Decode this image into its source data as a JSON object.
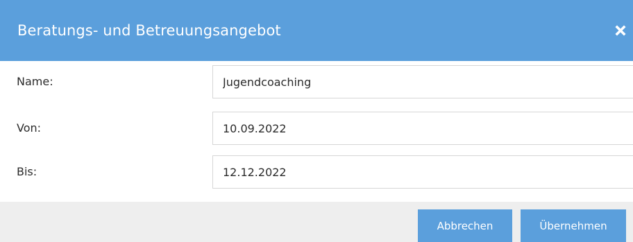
{
  "dialog": {
    "title": "Beratungs- und Betreuungsangebot",
    "close_icon": "close-icon",
    "header_color": "#5b9fdc"
  },
  "fields": [
    {
      "label": "Name:",
      "value": "Jugendcoaching"
    },
    {
      "label": "Von:",
      "value": "10.09.2022"
    },
    {
      "label": "Bis:",
      "value": "12.12.2022"
    }
  ],
  "footer": {
    "cancel_label": "Abbrechen",
    "apply_label": "Übernehmen",
    "button_color": "#5b9fdc"
  }
}
